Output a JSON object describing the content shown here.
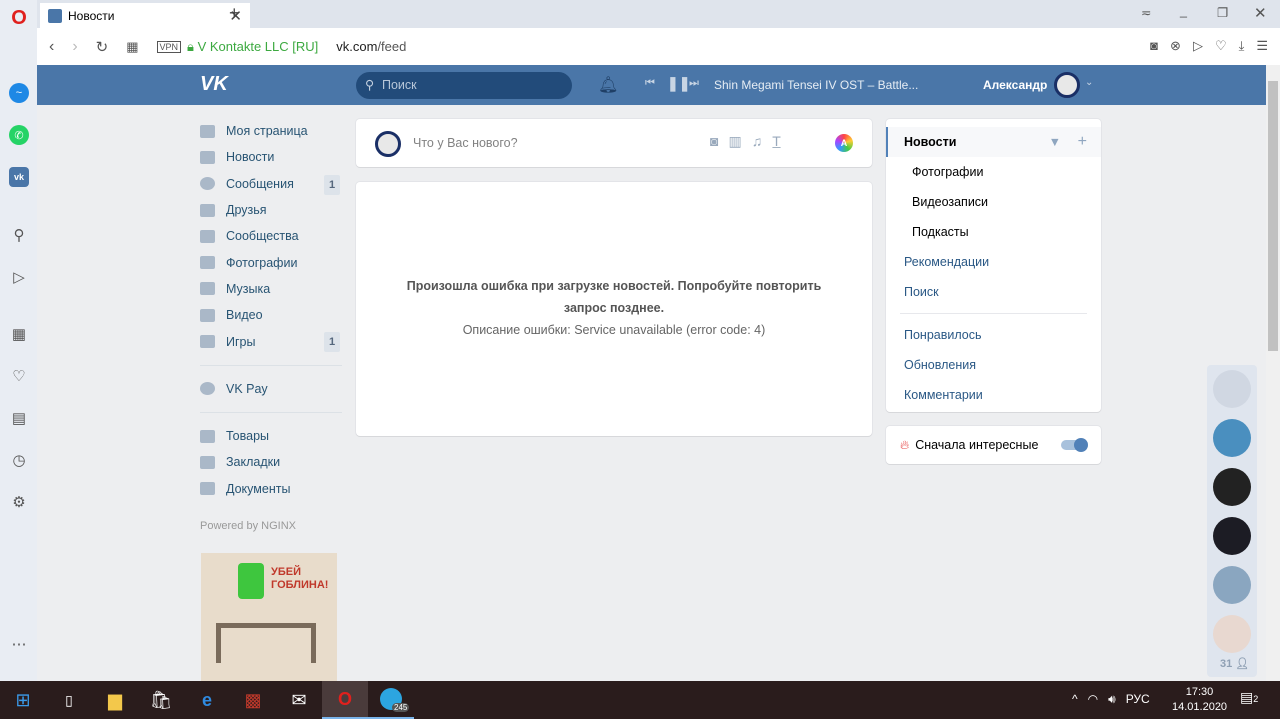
{
  "browser": {
    "tab_title": "Новости",
    "new_tab": "+",
    "vpn": "VPN",
    "cert": "V Kontakte LLC [RU]",
    "url_host": "vk.com",
    "url_path": "/feed"
  },
  "header": {
    "logo": "VK",
    "search_placeholder": "Поиск",
    "track": "Shin Megami Tensei IV OST – Battle...",
    "user": "Александр"
  },
  "left_menu": [
    {
      "label": "Моя страница"
    },
    {
      "label": "Новости"
    },
    {
      "label": "Сообщения",
      "badge": "1"
    },
    {
      "label": "Друзья"
    },
    {
      "label": "Сообщества"
    },
    {
      "label": "Фотографии"
    },
    {
      "label": "Музыка"
    },
    {
      "label": "Видео"
    },
    {
      "label": "Игры",
      "badge": "1"
    }
  ],
  "left_menu2": [
    {
      "label": "VK Pay"
    }
  ],
  "left_menu3": [
    {
      "label": "Товары"
    },
    {
      "label": "Закладки"
    },
    {
      "label": "Документы"
    }
  ],
  "powered": "Powered by NGINX",
  "ad": {
    "text": "УБЕЙ ГОБЛИНА!"
  },
  "post": {
    "placeholder": "Что у Вас нового?"
  },
  "error": {
    "title": "Произошла ошибка при загрузке новостей. Попробуйте повторить запрос позднее.",
    "desc": "Описание ошибки: Service unavailable (error code: 4)"
  },
  "right_nav": {
    "items": [
      "Новости",
      "Фотографии",
      "Видеозаписи",
      "Подкасты",
      "Рекомендации",
      "Поиск"
    ],
    "items2": [
      "Понравилось",
      "Обновления",
      "Комментарии"
    ],
    "interesting": "Сначала интересные",
    "interesting_on": true
  },
  "friends": {
    "count": "31"
  },
  "taskbar": {
    "lang": "РУС",
    "time": "17:30",
    "date": "14.01.2020",
    "telegram_badge": "245",
    "notif": "2"
  },
  "colors": {
    "vk_header": "#4a76a8",
    "link": "#2a5885"
  }
}
